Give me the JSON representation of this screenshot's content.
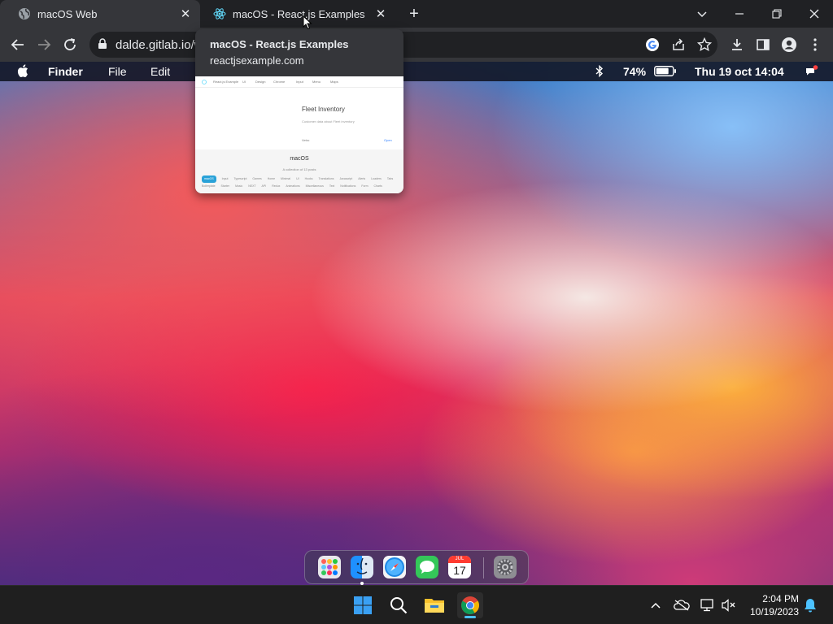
{
  "browser": {
    "tabs": [
      {
        "title": "macOS Web"
      },
      {
        "title": "macOS - React.js Examples"
      }
    ],
    "url": "dalde.gitlab.io/w",
    "tab_preview": {
      "title": "macOS - React.js Examples",
      "domain": "reactjsexample.com",
      "thumbnail": {
        "nav_items": [
          "React.js Example",
          "UI",
          "Design",
          "Chrome",
          "Input",
          "Menu",
          "Maps"
        ],
        "card_title": "Fleet Inventory",
        "card_desc": "Customer data about Fleet inventory",
        "card_site": "Vetro",
        "card_link": "Open",
        "section_title": "macOS",
        "section_sub": "A collection of 13 posts",
        "tags": [
          "macOS",
          "Input",
          "Typescript",
          "Games",
          "Home",
          "Minimal",
          "UI",
          "Hooks",
          "Translations",
          "Javascript",
          "Alerts",
          "Loaders",
          "Tabs",
          "Boilerplate",
          "Starter",
          "Music",
          "NEXT",
          "API",
          "Redux",
          "Animations",
          "Miscellaneous",
          "Text",
          "Notifications",
          "Form",
          "Charts"
        ]
      }
    }
  },
  "macos": {
    "menubar": {
      "items": [
        "Finder",
        "File",
        "Edit"
      ],
      "battery": "74%",
      "datetime": "Thu 19 oct 14:04"
    },
    "dock": {
      "apps": [
        "launchpad-icon",
        "finder-icon",
        "safari-icon",
        "messages-icon",
        "calendar-icon",
        "system-preferences-icon"
      ],
      "calendar_month": "JUL",
      "calendar_day": "17"
    }
  },
  "taskbar": {
    "time": "2:04 PM",
    "date": "10/19/2023"
  },
  "colors": {
    "chrome_dark": "#202124",
    "chrome_tab": "#35363a",
    "menubar": "#141828",
    "taskbar": "#1f1f1f"
  }
}
